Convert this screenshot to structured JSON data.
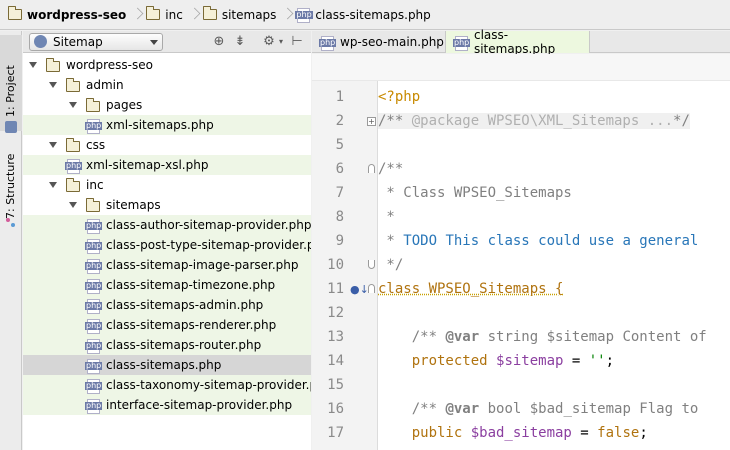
{
  "breadcrumb": [
    {
      "label": "wordpress-seo",
      "icon": "folder-icon",
      "bold": true
    },
    {
      "label": "inc",
      "icon": "folder-icon",
      "bold": false
    },
    {
      "label": "sitemaps",
      "icon": "folder-icon",
      "bold": false
    },
    {
      "label": "class-sitemaps.php",
      "icon": "php-file-icon",
      "bold": false
    }
  ],
  "stripe": {
    "project_tab": "1: Project",
    "structure_tab": "7: Structure"
  },
  "project_panel": {
    "view_selector": "Sitemap"
  },
  "tree": [
    {
      "label": "wordpress-seo",
      "type": "folder",
      "depth": 0,
      "expanded": true,
      "state": "normal"
    },
    {
      "label": "admin",
      "type": "folder",
      "depth": 1,
      "expanded": true,
      "state": "normal"
    },
    {
      "label": "pages",
      "type": "folder",
      "depth": 2,
      "expanded": true,
      "state": "normal"
    },
    {
      "label": "xml-sitemaps.php",
      "type": "php",
      "depth": 3,
      "state": "green"
    },
    {
      "label": "css",
      "type": "folder",
      "depth": 1,
      "expanded": true,
      "state": "normal"
    },
    {
      "label": "xml-sitemap-xsl.php",
      "type": "php",
      "depth": 2,
      "state": "green"
    },
    {
      "label": "inc",
      "type": "folder",
      "depth": 1,
      "expanded": true,
      "state": "normal"
    },
    {
      "label": "sitemaps",
      "type": "folder",
      "depth": 2,
      "expanded": true,
      "state": "normal"
    },
    {
      "label": "class-author-sitemap-provider.php",
      "type": "php",
      "depth": 3,
      "state": "green"
    },
    {
      "label": "class-post-type-sitemap-provider.php",
      "type": "php",
      "depth": 3,
      "state": "green"
    },
    {
      "label": "class-sitemap-image-parser.php",
      "type": "php",
      "depth": 3,
      "state": "green"
    },
    {
      "label": "class-sitemap-timezone.php",
      "type": "php",
      "depth": 3,
      "state": "green"
    },
    {
      "label": "class-sitemaps-admin.php",
      "type": "php",
      "depth": 3,
      "state": "green"
    },
    {
      "label": "class-sitemaps-renderer.php",
      "type": "php",
      "depth": 3,
      "state": "green"
    },
    {
      "label": "class-sitemaps-router.php",
      "type": "php",
      "depth": 3,
      "state": "green"
    },
    {
      "label": "class-sitemaps.php",
      "type": "php",
      "depth": 3,
      "state": "selected"
    },
    {
      "label": "class-taxonomy-sitemap-provider.php",
      "type": "php",
      "depth": 3,
      "state": "green"
    },
    {
      "label": "interface-sitemap-provider.php",
      "type": "php",
      "depth": 3,
      "state": "green"
    }
  ],
  "editor_tabs": [
    {
      "label": "wp-seo-main.php",
      "active": false
    },
    {
      "label": "class-sitemaps.php",
      "active": true
    }
  ],
  "code_lines": [
    {
      "n": "1",
      "tokens": [
        {
          "t": "<?php",
          "c": "tag"
        }
      ]
    },
    {
      "n": "2",
      "fold": "plus",
      "tokens": [
        {
          "t": "/** ",
          "c": "cm"
        },
        {
          "t": "@package WPSEO\\XML_Sitemaps ...",
          "c": "ph"
        },
        {
          "t": "*/",
          "c": "cm"
        }
      ]
    },
    {
      "n": "5",
      "tokens": []
    },
    {
      "n": "6",
      "fold": "start",
      "tokens": [
        {
          "t": "/**",
          "c": "dc"
        }
      ]
    },
    {
      "n": "7",
      "tokens": [
        {
          "t": " * Class WPSEO_Sitemaps",
          "c": "dc"
        }
      ]
    },
    {
      "n": "8",
      "tokens": [
        {
          "t": " *",
          "c": "dc"
        }
      ]
    },
    {
      "n": "9",
      "tokens": [
        {
          "t": " * ",
          "c": "dc"
        },
        {
          "t": "TODO This class could use a general",
          "c": "todo"
        }
      ]
    },
    {
      "n": "10",
      "fold": "end",
      "tokens": [
        {
          "t": " */",
          "c": "dc"
        }
      ]
    },
    {
      "n": "11",
      "fold": "start",
      "marker": true,
      "tokens": [
        {
          "t": "class WPSEO_Sitemaps {",
          "c": "kwc"
        }
      ]
    },
    {
      "n": "12",
      "tokens": []
    },
    {
      "n": "13",
      "tokens": [
        {
          "t": "    /** ",
          "c": "dc"
        },
        {
          "t": "@var",
          "c": "doctag"
        },
        {
          "t": " string $sitemap Content of",
          "c": "dc"
        }
      ]
    },
    {
      "n": "14",
      "tokens": [
        {
          "t": "    protected ",
          "c": "kwc"
        },
        {
          "t": "$sitemap",
          "c": "var2"
        },
        {
          "t": " = ",
          "c": "plain"
        },
        {
          "t": "''",
          "c": "str"
        },
        {
          "t": ";",
          "c": "plain"
        }
      ]
    },
    {
      "n": "15",
      "tokens": []
    },
    {
      "n": "16",
      "tokens": [
        {
          "t": "    /** ",
          "c": "dc"
        },
        {
          "t": "@var",
          "c": "doctag"
        },
        {
          "t": " bool $bad_sitemap Flag to",
          "c": "dc"
        }
      ]
    },
    {
      "n": "17",
      "tokens": [
        {
          "t": "    public ",
          "c": "kwc"
        },
        {
          "t": "$bad_sitemap",
          "c": "var2"
        },
        {
          "t": " = ",
          "c": "plain"
        },
        {
          "t": "false",
          "c": "kwc"
        },
        {
          "t": ";",
          "c": "plain"
        }
      ]
    }
  ]
}
